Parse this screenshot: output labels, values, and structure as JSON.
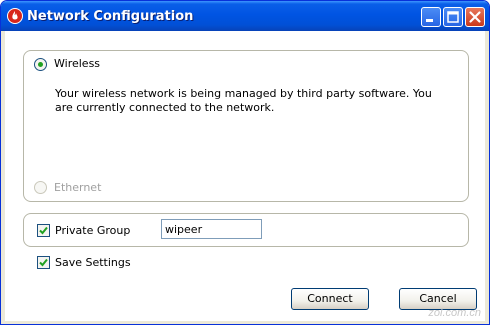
{
  "window": {
    "title": "Network Configuration"
  },
  "connection": {
    "wireless_label": "Wireless",
    "wireless_selected": true,
    "message": "Your wireless network is being managed by third party software. You are currently connected to the network.",
    "ethernet_label": "Ethernet",
    "ethernet_enabled": false
  },
  "private_group": {
    "label": "Private Group",
    "checked": true,
    "value": "wipeer"
  },
  "save_settings": {
    "label": "Save Settings",
    "checked": true
  },
  "buttons": {
    "connect": "Connect",
    "cancel": "Cancel"
  },
  "watermark": "zol.com.cn",
  "colors": {
    "titlebar": "#0054e3",
    "radio_dot": "#21a121",
    "check_mark": "#21a121"
  },
  "icons": {
    "app": "flame-logo-icon",
    "minimize": "minimize-icon",
    "maximize": "maximize-icon",
    "close": "close-icon"
  }
}
